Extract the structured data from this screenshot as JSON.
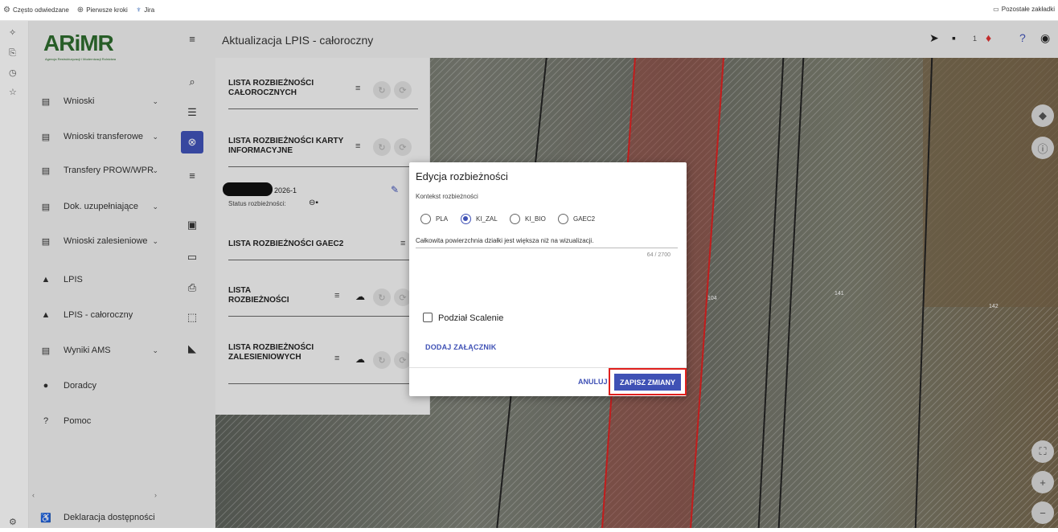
{
  "bookmarks": {
    "items": [
      {
        "icon": "gear-icon",
        "label": "Często odwiedzane"
      },
      {
        "icon": "globe-icon",
        "label": "Pierwsze kroki"
      },
      {
        "icon": "jira-icon",
        "label": "Jira"
      }
    ],
    "other": "Pozostałe zakładki"
  },
  "logo": {
    "text": "ARiMR",
    "subtitle": "Agencja Restrukturyzacji i Modernizacji Rolnictwa"
  },
  "sidebar": {
    "items": [
      {
        "label": "Wnioski",
        "icon": "document-icon",
        "chevron": true
      },
      {
        "label": "Wnioski transferowe",
        "icon": "document-icon",
        "chevron": true
      },
      {
        "label": "Transfery PROW/WPR",
        "icon": "document-icon",
        "chevron": true
      },
      {
        "label": "Dok. uzupełniające",
        "icon": "document-icon",
        "chevron": true
      },
      {
        "label": "Wnioski zalesieniowe",
        "icon": "document-icon",
        "chevron": true
      },
      {
        "label": "LPIS",
        "icon": "mountain-icon",
        "chevron": false
      },
      {
        "label": "LPIS - całoroczny",
        "icon": "mountain-icon",
        "chevron": false
      },
      {
        "label": "Wyniki AMS",
        "icon": "document-icon",
        "chevron": true
      },
      {
        "label": "Doradcy",
        "icon": "person-icon",
        "chevron": false
      },
      {
        "label": "Pomoc",
        "icon": "help-icon",
        "chevron": false
      }
    ],
    "footer": "Deklaracja dostępności"
  },
  "topbar": {
    "title": "Aktualizacja LPIS - całoroczny",
    "notification_count": "1"
  },
  "panel": {
    "lists": [
      {
        "title": "LISTA ROZBIEŻNOŚCI CAŁOROCZNYCH"
      },
      {
        "title": "LISTA ROZBIEŻNOŚCI KARTY INFORMACYJNE"
      },
      {
        "title": "LISTA ROZBIEŻNOŚCI GAEC2"
      },
      {
        "title": "LISTA ROZBIEŻNOŚCI"
      },
      {
        "title": "LISTA ROZBIEŻNOŚCI ZALESIENIOWYCH"
      }
    ],
    "record_id_suffix": "2026-1",
    "record_status": "Status rozbieżności:"
  },
  "map": {
    "parcels": [
      "104",
      "141",
      "142"
    ]
  },
  "dialog": {
    "title": "Edycja rozbieżności",
    "context_label": "Kontekst rozbieżności",
    "options": [
      "PLA",
      "KI_ZAL",
      "KI_BIO",
      "GAEC2"
    ],
    "selected": "KI_ZAL",
    "text": "Całkowita powierzchnia działki jest większa niż na wizualizacji.",
    "counter": "64 / 2700",
    "checkbox_label": "Podział Scalenie",
    "checkbox_checked": false,
    "attach_label": "DODAJ ZAŁĄCZNIK",
    "cancel_label": "ANULUJ",
    "save_label": "ZAPISZ ZMIANY"
  },
  "colors": {
    "primary": "#3f51b5",
    "highlight": "#e0201d",
    "logo": "#2d6a2d"
  }
}
